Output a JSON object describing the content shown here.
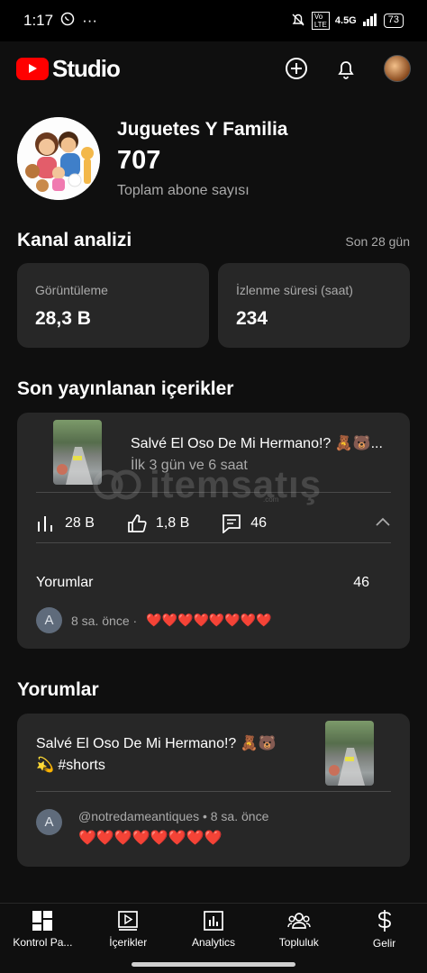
{
  "status_bar": {
    "time": "1:17",
    "dots": "···",
    "network": "4.5G",
    "battery": "73"
  },
  "header": {
    "logo_text": "Studio",
    "brand_color": "#ff0000"
  },
  "channel": {
    "name": "Juguetes Y Familia",
    "subscribers": "707",
    "subscribers_label": "Toplam abone sayısı"
  },
  "analytics": {
    "title": "Kanal analizi",
    "period": "Son 28 gün",
    "cards": [
      {
        "label": "Görüntüleme",
        "value": "28,3 B"
      },
      {
        "label": "İzlenme süresi (saat)",
        "value": "234"
      }
    ]
  },
  "recent": {
    "title": "Son yayınlanan içerikler",
    "video_title": "Salvé El Oso De Mi Hermano!? 🧸🐻...",
    "video_sub": "İlk 3 gün ve 6 saat",
    "views": "28 B",
    "likes": "1,8 B",
    "comments": "46",
    "comments_label": "Yorumlar",
    "comments_count": "46",
    "avatar_letter": "A",
    "comment_time": "8 sa. önce ·",
    "comment_text": "❤️❤️❤️❤️❤️❤️❤️❤️"
  },
  "comments_section": {
    "title": "Yorumlar",
    "video_title_line1": "Salvé El Oso De Mi Hermano!? 🧸🐻",
    "video_title_line2": "💫 #shorts",
    "avatar_letter": "A",
    "author_meta": "@notredameantiques • 8 sa. önce",
    "comment_text": "❤️❤️❤️❤️❤️❤️❤️❤️"
  },
  "watermark": {
    "text": "itemsatış",
    "sub": ".com"
  },
  "bottom_nav": [
    {
      "label": "Kontrol Pa...",
      "icon": "dashboard-icon"
    },
    {
      "label": "İçerikler",
      "icon": "content-icon"
    },
    {
      "label": "Analytics",
      "icon": "analytics-icon"
    },
    {
      "label": "Topluluk",
      "icon": "community-icon"
    },
    {
      "label": "Gelir",
      "icon": "earn-icon"
    }
  ]
}
